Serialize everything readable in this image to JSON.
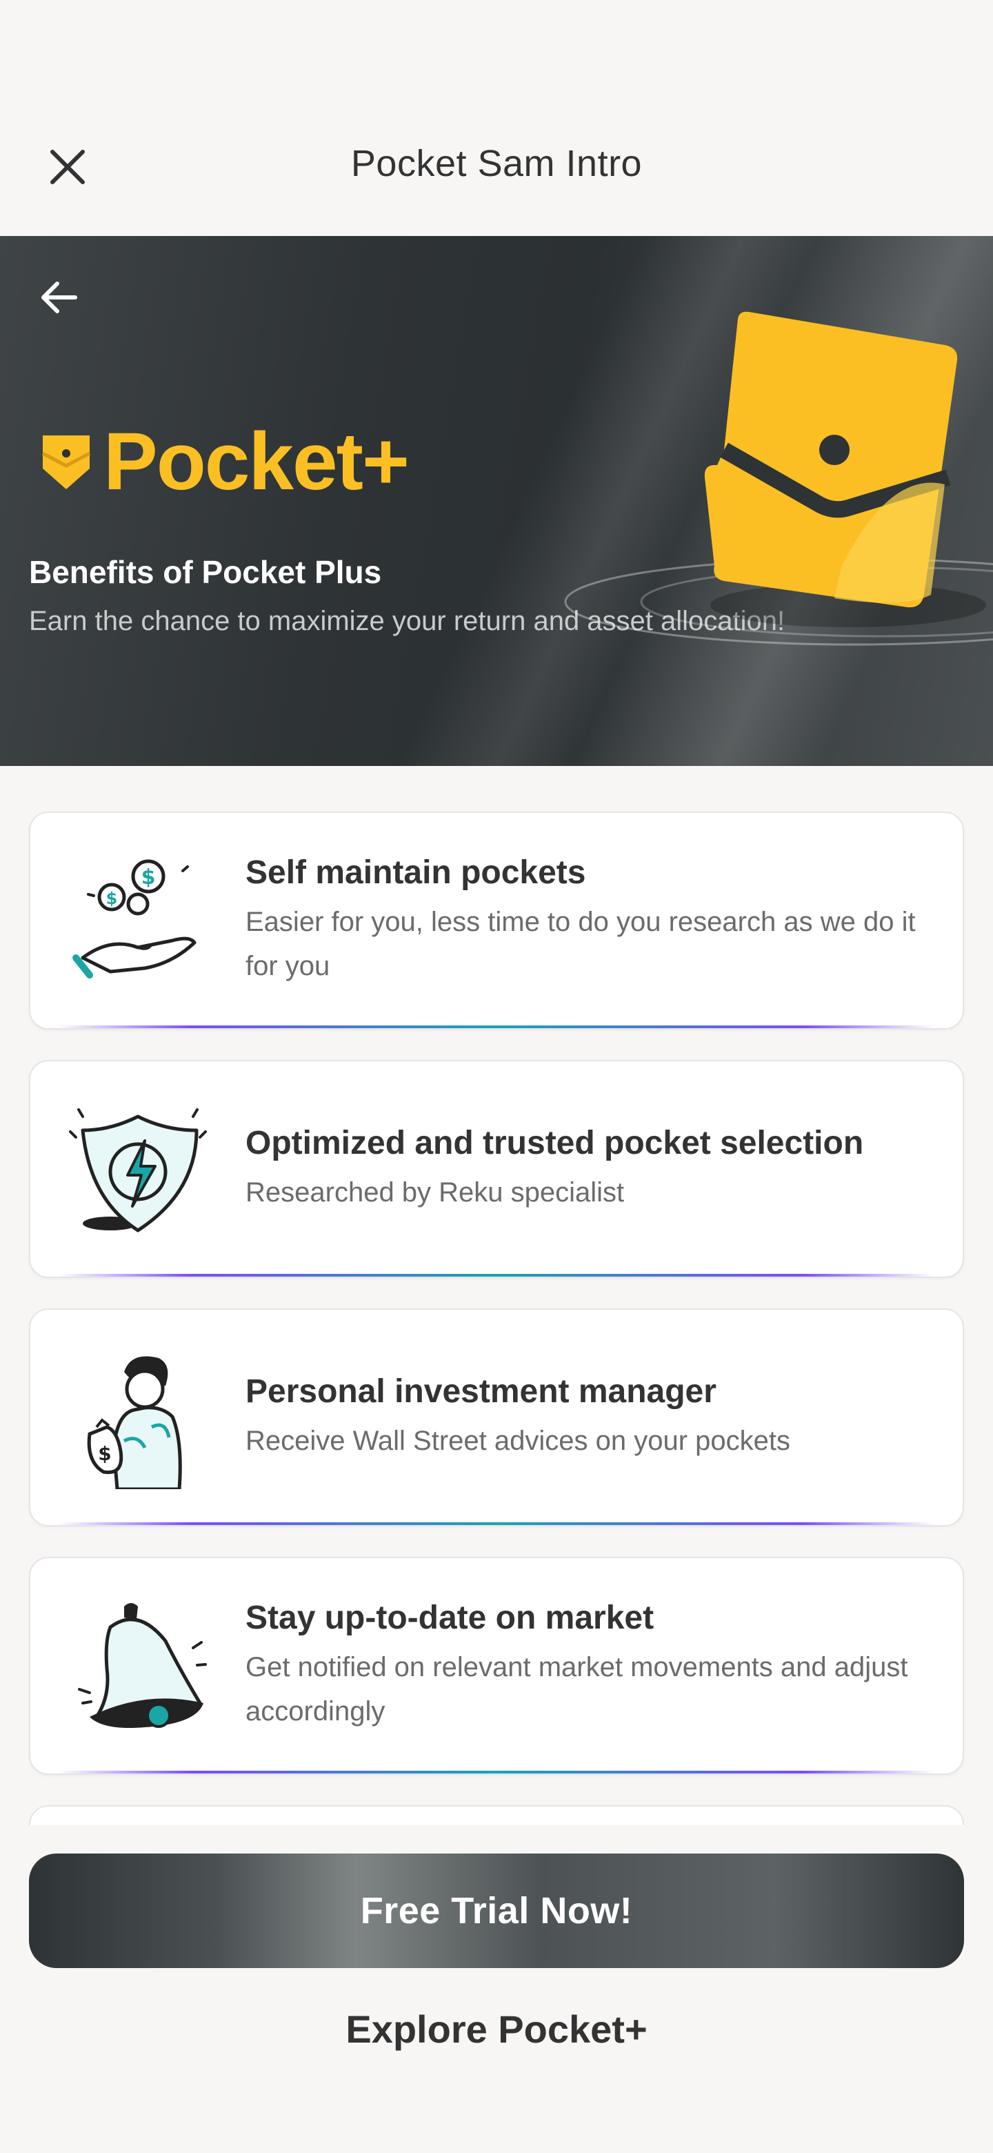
{
  "header": {
    "title": "Pocket Sam Intro",
    "close_icon": "close-icon"
  },
  "hero": {
    "back_icon": "arrow-left-icon",
    "brand_name": "Pocket+",
    "title": "Benefits of Pocket Plus",
    "subtitle": "Earn the chance to maximize your return and asset allocation!",
    "accent_color": "#fbbf24"
  },
  "benefits": [
    {
      "title": "Self maintain pockets",
      "description": "Easier for you, less time to do you research as we do it for you",
      "icon": "hand-coins-icon"
    },
    {
      "title": "Optimized and trusted pocket selection",
      "description": "Researched by Reku specialist",
      "icon": "shield-bolt-icon"
    },
    {
      "title": "Personal investment manager",
      "description": "Receive Wall Street advices on your pockets",
      "icon": "investment-manager-icon"
    },
    {
      "title": "Stay up-to-date on market",
      "description": "Get notified on relevant market movements and adjust accordingly",
      "icon": "bell-icon"
    }
  ],
  "actions": {
    "primary": "Free Trial Now!",
    "secondary": "Explore Pocket+"
  }
}
